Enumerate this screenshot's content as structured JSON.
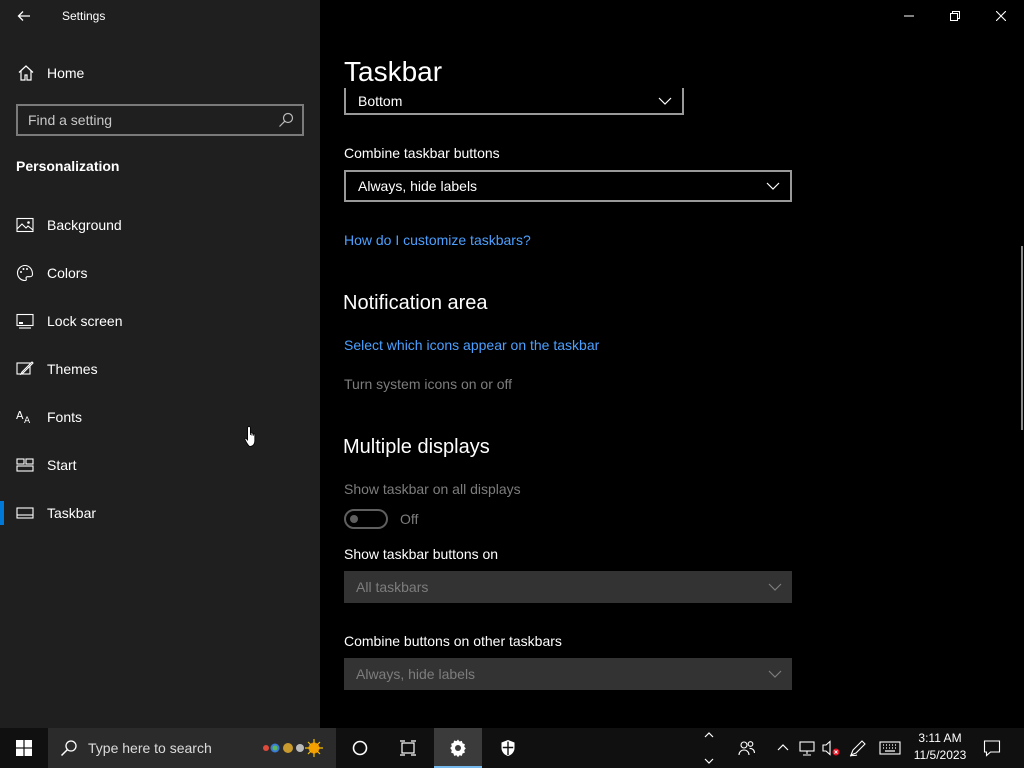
{
  "window": {
    "app_title": "Settings"
  },
  "sidebar": {
    "home_label": "Home",
    "search_placeholder": "Find a setting",
    "section_title": "Personalization",
    "items": [
      {
        "label": "Background",
        "icon": "image-icon"
      },
      {
        "label": "Colors",
        "icon": "palette-icon"
      },
      {
        "label": "Lock screen",
        "icon": "lock-screen-icon"
      },
      {
        "label": "Themes",
        "icon": "themes-icon"
      },
      {
        "label": "Fonts",
        "icon": "fonts-icon"
      },
      {
        "label": "Start",
        "icon": "start-icon"
      },
      {
        "label": "Taskbar",
        "icon": "taskbar-icon",
        "selected": true
      }
    ]
  },
  "main": {
    "page_title": "Taskbar",
    "location_dropdown_value": "Bottom",
    "combine_label": "Combine taskbar buttons",
    "combine_value": "Always, hide labels",
    "customize_link": "How do I customize taskbars?",
    "notification_heading": "Notification area",
    "select_icons_link": "Select which icons appear on the taskbar",
    "system_icons_link": "Turn system icons on or off",
    "multiple_displays_heading": "Multiple displays",
    "show_all_label": "Show taskbar on all displays",
    "show_all_state": "Off",
    "show_buttons_on_label": "Show taskbar buttons on",
    "show_buttons_on_value": "All taskbars",
    "combine_other_label": "Combine buttons on other taskbars",
    "combine_other_value": "Always, hide labels"
  },
  "taskbar": {
    "search_placeholder": "Type here to search",
    "clock_time": "3:11 AM",
    "clock_date": "11/5/2023"
  },
  "colors": {
    "accent": "#0078d7",
    "link": "#4ca0ff",
    "sidebar_bg": "#1f1f1f",
    "content_bg": "#000000",
    "taskbar_bg": "#101010"
  }
}
